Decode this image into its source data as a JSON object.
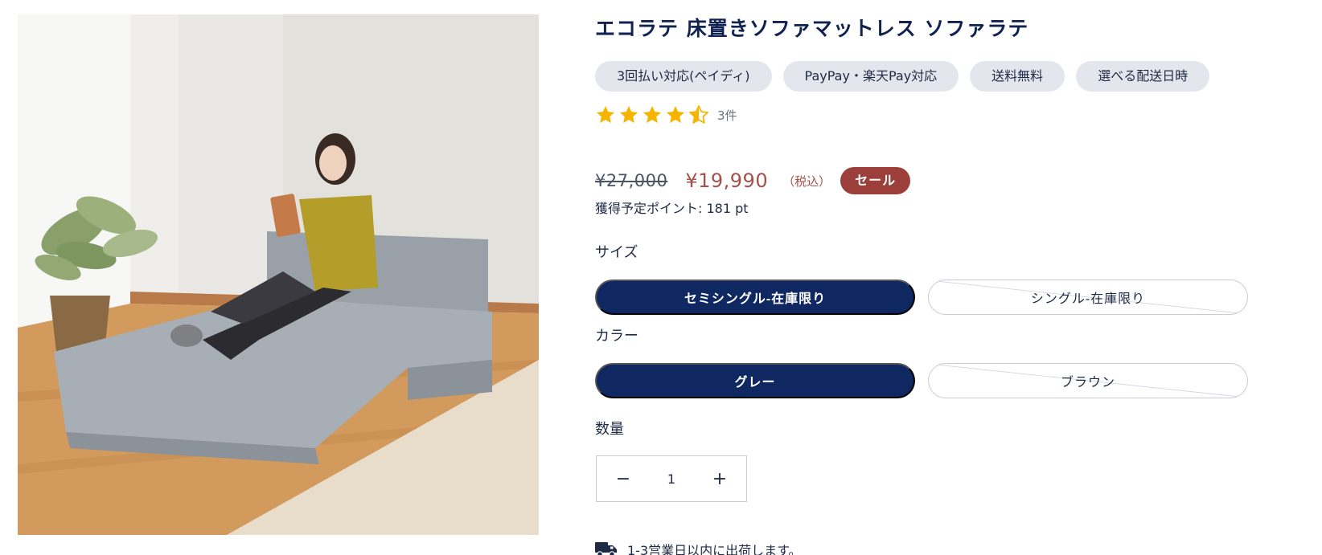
{
  "product": {
    "title": "エコラテ 床置きソファマットレス ソファラテ",
    "badges": [
      "3回払い対応(ペイディ)",
      "PayPay・楽天Pay対応",
      "送料無料",
      "選べる配送日時"
    ],
    "rating": {
      "stars": 4.5,
      "max": 5,
      "count_label": "3件"
    },
    "price": {
      "original": "¥27,000",
      "sale": "¥19,990",
      "tax_note": "（税込）",
      "sale_badge": "セール"
    },
    "points": "獲得予定ポイント: 181 pt"
  },
  "options": {
    "size": {
      "label": "サイズ",
      "values": [
        {
          "label": "セミシングル-在庫限り",
          "state": "selected"
        },
        {
          "label": "シングル-在庫限り",
          "state": "unavailable"
        }
      ]
    },
    "color": {
      "label": "カラー",
      "values": [
        {
          "label": "グレー",
          "state": "selected"
        },
        {
          "label": "ブラウン",
          "state": "unavailable"
        }
      ]
    }
  },
  "quantity": {
    "label": "数量",
    "value": "1",
    "minus": "−",
    "plus": "+"
  },
  "shipping": {
    "text": "1-3営業日以内に出荷します。",
    "icon": "truck-icon"
  },
  "colors": {
    "navy": "#0f2862",
    "sale_red": "#9c3f3a",
    "price_red": "#a6504a",
    "badge_bg": "#e3e7ed",
    "star": "#f4b400"
  }
}
